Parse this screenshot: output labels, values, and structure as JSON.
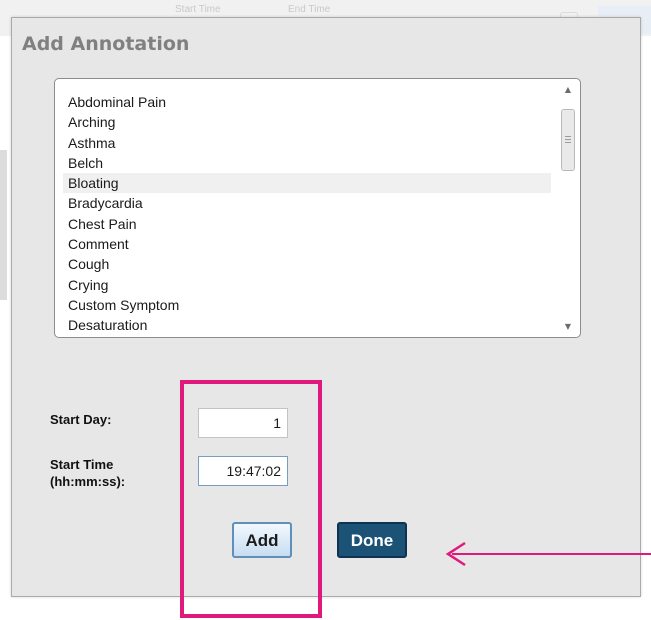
{
  "background": {
    "column_1": "Start Time",
    "column_2": "End Time"
  },
  "dialog": {
    "title": "Add Annotation",
    "annotation_list": {
      "items": [
        "Abdominal Pain",
        "Arching",
        "Asthma",
        "Belch",
        "Bloating",
        "Bradycardia",
        "Chest Pain",
        "Comment",
        "Cough",
        "Crying",
        "Custom Symptom",
        "Desaturation"
      ],
      "selected": "Bloating"
    },
    "start_day": {
      "label": "Start Day:",
      "value": "1"
    },
    "start_time": {
      "label_line1": "Start Time",
      "label_line2": "(hh:mm:ss):",
      "value": "19:47:02"
    },
    "add_label": "Add",
    "done_label": "Done"
  },
  "colors": {
    "highlight": "#e0197d",
    "done_button": "#1c5275",
    "add_button_border": "#5f8fba"
  },
  "icons": [
    "scroll-up-icon",
    "scroll-down-icon",
    "arrow-left-icon"
  ]
}
